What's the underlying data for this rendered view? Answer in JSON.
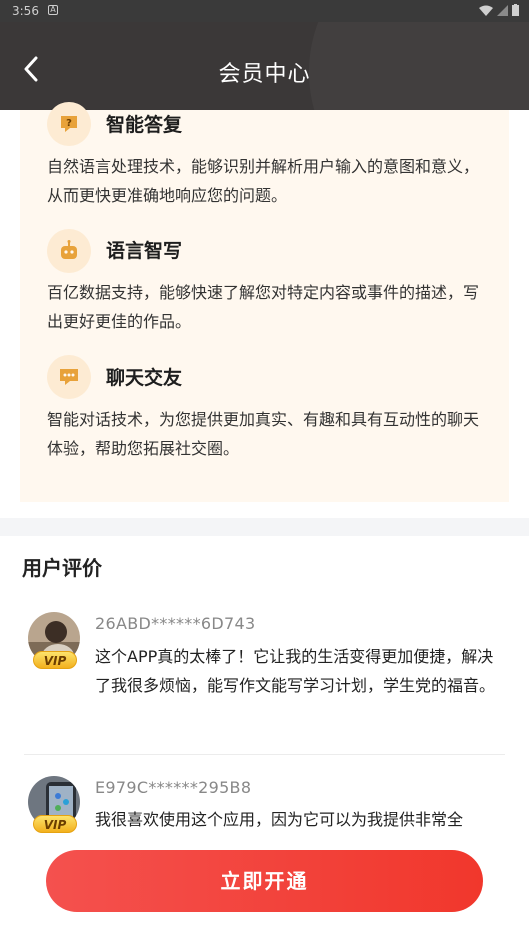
{
  "status_bar": {
    "time": "3:56",
    "notif_icon": "A"
  },
  "header": {
    "title": "会员中心"
  },
  "features": [
    {
      "icon": "question-bubble-icon",
      "title": "智能答复",
      "desc": "自然语言处理技术，能够识别并解析用户输入的意图和意义，从而更快更准确地响应您的问题。"
    },
    {
      "icon": "robot-icon",
      "title": "语言智写",
      "desc": "百亿数据支持，能够快速了解您对特定内容或事件的描述，写出更好更佳的作品。"
    },
    {
      "icon": "chat-bubble-icon",
      "title": "聊天交友",
      "desc": "智能对话技术，为您提供更加真实、有趣和具有互动性的聊天体验，帮助您拓展社交圈。"
    }
  ],
  "reviews_title": "用户评价",
  "reviews": [
    {
      "user": "26ABD******6D743",
      "badge": "VIP",
      "text": "这个APP真的太棒了！它让我的生活变得更加便捷，解决了我很多烦恼，能写作文能写学习计划，学生党的福音。"
    },
    {
      "user": "E979C******295B8",
      "badge": "VIP",
      "text": "我很喜欢使用这个应用，因为它可以为我提供非常全"
    }
  ],
  "cta": {
    "label": "立即开通"
  },
  "colors": {
    "header_bg": "#3b3838",
    "card_bg": "#fff8ef",
    "cta": "#f2412f",
    "vip_gold": "#f2b01e"
  }
}
